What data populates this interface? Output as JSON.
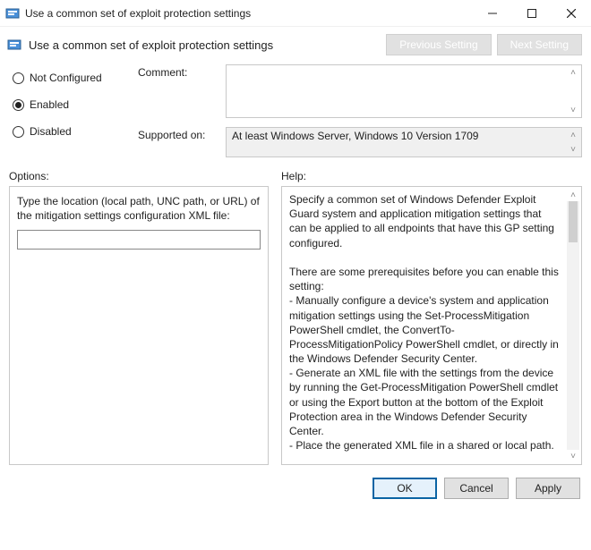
{
  "window": {
    "title": "Use a common set of exploit protection settings"
  },
  "sub": {
    "title": "Use a common set of exploit protection settings",
    "prev": "Previous Setting",
    "next": "Next Setting"
  },
  "state": {
    "not_configured": "Not Configured",
    "enabled": "Enabled",
    "disabled": "Disabled",
    "selected": "enabled"
  },
  "comment": {
    "label": "Comment:",
    "value": ""
  },
  "supported": {
    "label": "Supported on:",
    "value": "At least Windows Server, Windows 10 Version 1709"
  },
  "sections": {
    "options": "Options:",
    "help": "Help:"
  },
  "options": {
    "prompt": "Type the location (local path, UNC path, or URL) of the  mitigation settings configuration XML file:",
    "input_value": ""
  },
  "help": {
    "text": "Specify a common set of Windows Defender Exploit Guard system and application mitigation settings that can be applied to all endpoints that have this GP setting configured.\n\nThere are some prerequisites before you can enable this setting:\n- Manually configure a device's system and application mitigation settings using the Set-ProcessMitigation PowerShell cmdlet, the ConvertTo-ProcessMitigationPolicy PowerShell cmdlet, or directly in the Windows Defender Security Center.\n- Generate an XML file with the settings from the device by running the Get-ProcessMitigation PowerShell cmdlet or using the Export button at the bottom of the Exploit Protection area in the Windows Defender Security Center.\n- Place the generated XML file in a shared or local path.\n\nNote: Endpoints that have this GP setting set to Enabled must be able to access the XML file, otherwise the settings will not be applied.\n\nEnabled\nSpecify the location of the XML file in the Options section. You"
  },
  "buttons": {
    "ok": "OK",
    "cancel": "Cancel",
    "apply": "Apply"
  }
}
